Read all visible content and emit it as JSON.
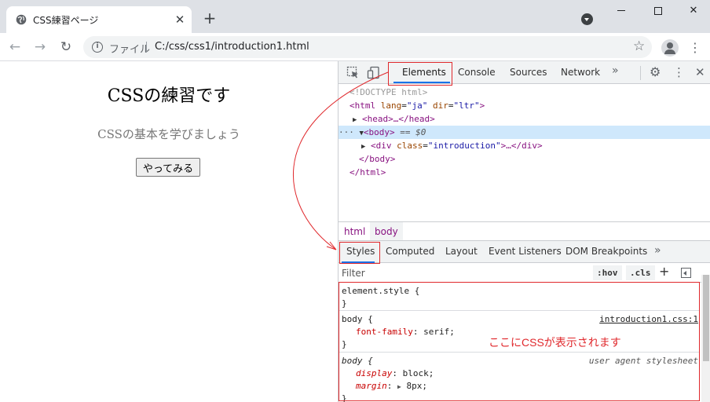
{
  "browser": {
    "tab_title": "CSS練習ページ",
    "tab_close": "✕",
    "new_tab": "+",
    "window_buttons": {
      "close": "✕"
    },
    "address_bar": {
      "info_icon": "i",
      "scheme_label": "ファイル",
      "url": "C:/css/css1/introduction1.html"
    },
    "nav": {
      "back": "←",
      "forward": "→",
      "reload": "↻"
    },
    "icons": {
      "star": "☆",
      "menu": "⋮"
    }
  },
  "page": {
    "heading": "CSSの練習です",
    "lead": "CSSの基本を学びましょう",
    "button_label": "やってみる"
  },
  "devtools": {
    "tabs": [
      "Elements",
      "Console",
      "Sources",
      "Network"
    ],
    "more": "»",
    "gear": "⚙",
    "kebab": "⋮",
    "close": "✕",
    "dom": {
      "doctype": "<!DOCTYPE html>",
      "html_open": "<html",
      "attr_lang": "lang",
      "val_lang": "\"ja\"",
      "attr_dir": "dir",
      "val_dir": "\"ltr\"",
      "head_collapsed": "<head>…</head>",
      "body_open": "<body>",
      "selected_marker": "== $0",
      "div_open": "<div",
      "attr_class": "class",
      "val_class": "\"introduction\"",
      "div_rest": ">…</div>",
      "body_close": "</body>",
      "html_close": "</html>"
    },
    "breadcrumbs": [
      "html",
      "body"
    ],
    "sub_tabs": [
      "Styles",
      "Computed",
      "Layout",
      "Event Listeners",
      "DOM Breakpoints"
    ],
    "sub_more": "»",
    "filter_placeholder": "Filter",
    "hov_label": ":hov",
    "cls_label": ".cls",
    "plus_label": "+",
    "styles": {
      "element_style_selector": "element.style {",
      "rule_close": "}",
      "author_rule": {
        "selector": "body {",
        "source": "introduction1.css:1",
        "prop": "font-family",
        "value": "serif;"
      },
      "ua_rule": {
        "selector": "body {",
        "source": "user agent stylesheet",
        "prop1": "display",
        "value1": "block;",
        "prop2": "margin",
        "value2": "8px;"
      }
    }
  },
  "annotation": {
    "text": "ここにCSSが表示されます",
    "color": "#e0282c"
  },
  "colors": {
    "chrome_bg": "#dee1e6",
    "accent": "#1a73e8",
    "tag": "#881280",
    "selection": "#cfe8fc"
  }
}
